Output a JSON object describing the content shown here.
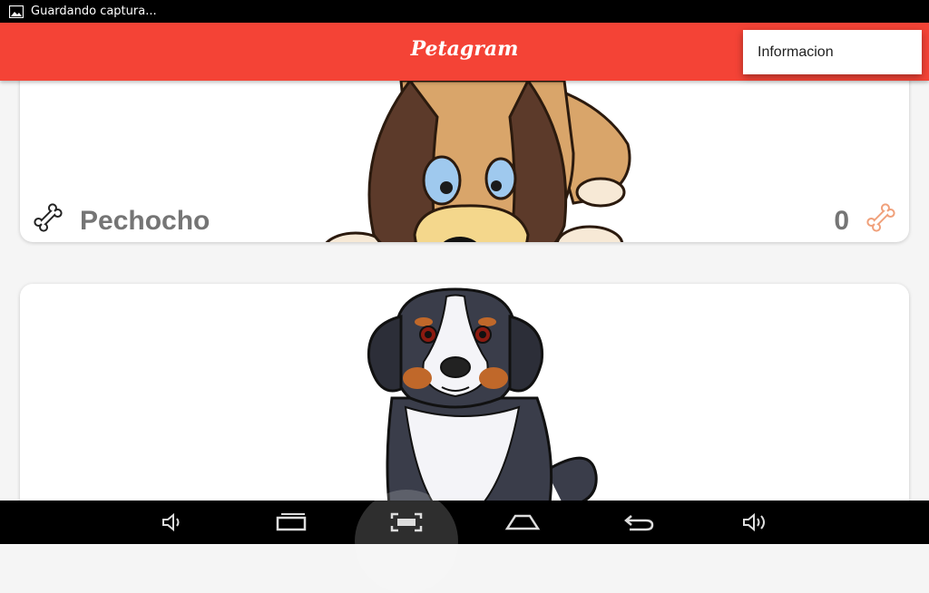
{
  "status_bar": {
    "notification_text": "Guardando captura...",
    "icon": "image-icon"
  },
  "app_bar": {
    "title": "Petagram",
    "color": "#f44336"
  },
  "overflow_menu": {
    "items": [
      {
        "label": "Informacion"
      }
    ]
  },
  "pets": [
    {
      "name": "Pechocho",
      "likes": "0",
      "image": "basset-hound-cartoon"
    },
    {
      "name": "",
      "likes": "",
      "image": "bernese-mountain-dog-cartoon"
    }
  ],
  "nav_bar": {
    "buttons": [
      "volume-down-icon",
      "recent-apps-icon",
      "screenshot-icon",
      "home-icon",
      "back-icon",
      "volume-up-icon"
    ]
  }
}
